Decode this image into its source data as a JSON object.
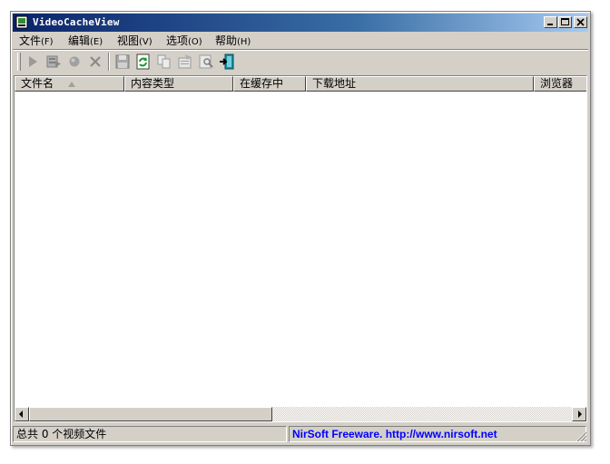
{
  "window": {
    "title": "VideoCacheView",
    "controls": [
      "minimize-icon",
      "maximize-icon",
      "close-icon"
    ]
  },
  "menu": {
    "items": [
      {
        "label": "文件",
        "mnemonic": "(F)"
      },
      {
        "label": "编辑",
        "mnemonic": "(E)"
      },
      {
        "label": "视图",
        "mnemonic": "(V)"
      },
      {
        "label": "选项",
        "mnemonic": "(O)"
      },
      {
        "label": "帮助",
        "mnemonic": "(H)"
      }
    ]
  },
  "toolbar": {
    "icons": [
      "play-icon",
      "play-with-icon",
      "record-icon",
      "delete-icon",
      "save-icon",
      "refresh-icon",
      "copy-icon",
      "properties-icon",
      "find-icon",
      "exit-icon"
    ]
  },
  "list": {
    "columns": [
      "文件名",
      "内容类型",
      "在缓存中",
      "下载地址",
      "浏览器"
    ],
    "sort_column": "文件名",
    "rows": []
  },
  "status": {
    "count_text": "总共 0 个视频文件",
    "credit_text": "NirSoft Freeware.  http://www.nirsoft.net"
  },
  "colors": {
    "title_gradient_start": "#0a246a",
    "title_gradient_end": "#a6caf0",
    "window_face": "#d4d0c8",
    "link": "#0000ff"
  }
}
